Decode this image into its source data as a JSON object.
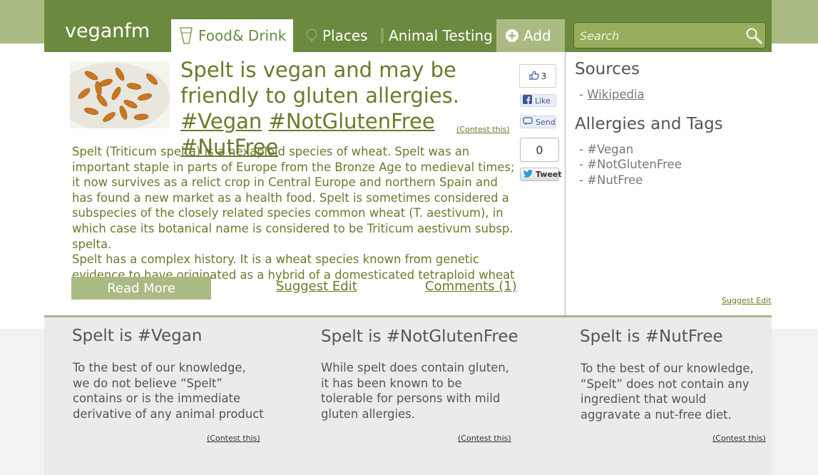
{
  "header": {
    "logo": "veganfm",
    "tabs": [
      {
        "label": "Food& Drink",
        "icon": "glass-icon"
      },
      {
        "label": "Places",
        "icon": "location-icon"
      },
      {
        "label": "Animal Testing",
        "icon": "test-tube-icon"
      },
      {
        "label": "Add",
        "icon": "plus-circle-icon"
      }
    ],
    "search_placeholder": "Search"
  },
  "article": {
    "title_plain": "Spelt is vegan and may be friendly to gluten allergies.",
    "title_tags": [
      "#Vegan",
      "#NotGlutenFree",
      "#NutFree"
    ],
    "contest_label": "(Contest this)",
    "body": "Spelt (Triticum spelta) is a hexaploid species of wheat. Spelt was an important staple in parts of Europe from the Bronze Age to medieval times; it now survives as a relict crop in Central Europe and northern Spain and has found a new market as a health food. Spelt is sometimes considered a subspecies of the closely related species common wheat (T. aestivum), in which case its botanical name is considered to be Triticum aestivum subsp. spelta.",
    "body2": "Spelt has a complex history. It is a wheat species known from genetic evidence to have originated as a hybrid of a domesticated tetraploid wheat such...",
    "read_more": "Read More",
    "suggest_edit": "Suggest Edit",
    "comments": "Comments (1)"
  },
  "social": {
    "like_count": "3",
    "like_label": "Like",
    "send_label": "Send",
    "tweet_count": "0",
    "tweet_label": "Tweet"
  },
  "sidebar": {
    "sources_heading": "Sources",
    "sources": [
      "Wikipedia"
    ],
    "tags_heading": "Allergies and Tags",
    "tags": [
      "#Vegan",
      "#NotGlutenFree",
      "#NutFree"
    ],
    "suggest_edit": "Suggest Edit"
  },
  "cards": [
    {
      "title": "Spelt is #Vegan",
      "text": "To the best of our knowledge, we do not believe “Spelt” contains or is the immediate derivative of any animal product",
      "contest": "(Contest this)"
    },
    {
      "title": "Spelt is #NotGlutenFree",
      "text": "While spelt does contain gluten, it has been known to be tolerable for persons with mild gluten allergies.",
      "contest": "(Contest this)"
    },
    {
      "title": "Spelt is #NutFree",
      "text": "To the best of our knowledge, “Spelt” does not contain any ingredient that would aggravate a nut-free diet.",
      "contest": "(Contest this)"
    }
  ],
  "colors": {
    "header": "#6b8a3f",
    "accent_light": "#a9bb83",
    "text_green": "#6b7a2b"
  }
}
